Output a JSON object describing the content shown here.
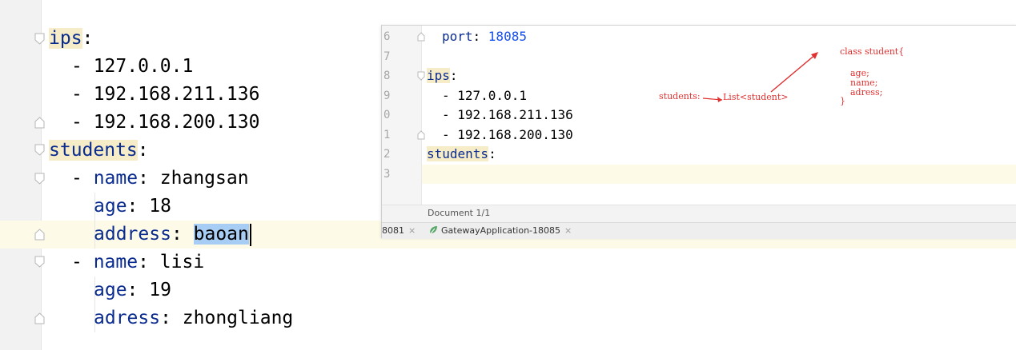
{
  "main_editor": {
    "lines": [
      {
        "key": "ips",
        "sep": ":"
      },
      {
        "dash": "- ",
        "value": "127.0.0.1"
      },
      {
        "dash": "- ",
        "value": "192.168.211.136"
      },
      {
        "dash": "- ",
        "value": "192.168.200.130"
      },
      {
        "key": "students",
        "sep": ":"
      },
      {
        "dash": "- ",
        "key": "name",
        "sep": ": ",
        "value": "zhangsan"
      },
      {
        "key": "age",
        "sep": ": ",
        "value": "18"
      },
      {
        "key": "address",
        "sep": ": ",
        "value": "baoan"
      },
      {
        "dash": "- ",
        "key": "name",
        "sep": ": ",
        "value": "lisi"
      },
      {
        "key": "age",
        "sep": ": ",
        "value": "19"
      },
      {
        "key": "adress",
        "sep": ": ",
        "value": "zhongliang"
      }
    ]
  },
  "overlay_editor": {
    "line_numbers": [
      "6",
      "7",
      "8",
      "9",
      "0",
      "1",
      "2",
      "3"
    ],
    "lines": [
      {
        "key": "port",
        "sep": ": ",
        "value": "18085"
      },
      {},
      {
        "key": "ips",
        "sep": ":"
      },
      {
        "dash": "- ",
        "value": "127.0.0.1"
      },
      {
        "dash": "- ",
        "value": "192.168.211.136"
      },
      {
        "dash": "- ",
        "value": "192.168.200.130"
      },
      {
        "key": "students",
        "sep": ":"
      },
      {}
    ],
    "status": "Document 1/1",
    "tabs": [
      {
        "label": "8081",
        "close": "×"
      },
      {
        "label": "GatewayApplication-18085",
        "close": "×"
      }
    ],
    "annotations": {
      "students_label": "students:",
      "list_label": "List<student>",
      "class_header": "class student{",
      "fields": [
        "age;",
        "name;",
        "adress;"
      ],
      "close_brace": "}"
    }
  },
  "colors": {
    "key": "#0b2c8f",
    "port_value": "#1750eb",
    "key_highlight": "#f6ecc8",
    "selection": "#a8cdf4",
    "caret_line": "#fdfbe8",
    "annotation_red": "#e03030",
    "run_icon_green": "#59a869"
  }
}
